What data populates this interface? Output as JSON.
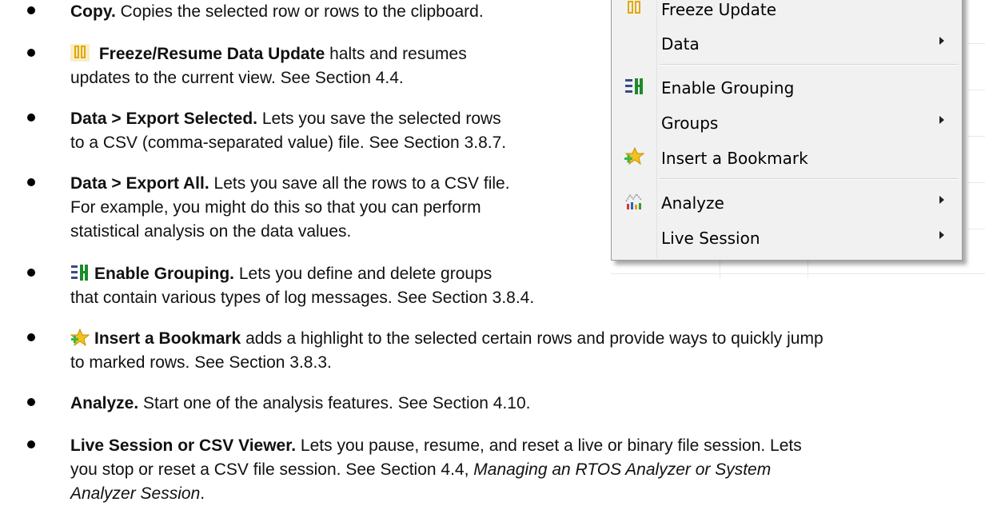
{
  "bullets": {
    "copy": {
      "title": "Copy.",
      "text": " Copies the selected row or rows to the clipboard."
    },
    "freeze": {
      "title": "Freeze/Resume Data Update",
      "text1": " halts and resumes",
      "text2": "updates to the current view. See Section 4.4."
    },
    "export_selected": {
      "title": "Data > Export Selected.",
      "text1": " Lets you save the selected rows",
      "text2": "to a CSV (comma-separated value) file. See Section 3.8.7."
    },
    "export_all": {
      "title": "Data > Export All.",
      "text1": " Lets you save all the rows to a CSV file.",
      "text2": "For example, you might do this so that you can perform",
      "text3": "statistical analysis on the data values."
    },
    "grouping": {
      "title": "Enable Grouping.",
      "text1": " Lets you define and delete groups",
      "text2": "that contain various types of log messages. See Section 3.8.4."
    },
    "bookmark": {
      "title": "Insert a Bookmark",
      "text1": " adds a highlight to the selected certain rows and provide ways to quickly jump",
      "text2": "to marked rows. See Section 3.8.3."
    },
    "analyze": {
      "title": "Analyze.",
      "text": " Start one of the analysis features. See Section 4.10."
    },
    "live": {
      "title": "Live Session or CSV Viewer.",
      "text1": " Lets you pause, resume, and reset a live or binary file session. Lets",
      "text2": "you stop or reset a CSV file session. See Section 4.4, ",
      "italic1": "Managing an RTOS Analyzer or System",
      "italic2": "Analyzer Session",
      "tail": "."
    }
  },
  "menu": {
    "items": [
      {
        "label": "Freeze Update",
        "icon": "freeze-icon",
        "submenu": false
      },
      {
        "label": "Data",
        "icon": "",
        "submenu": true
      },
      {
        "label": "Enable Grouping",
        "icon": "grouping-icon",
        "submenu": false
      },
      {
        "label": "Groups",
        "icon": "",
        "submenu": true
      },
      {
        "label": "Insert a Bookmark",
        "icon": "bookmark-icon",
        "submenu": false
      },
      {
        "label": "Analyze",
        "icon": "analyze-icon",
        "submenu": true
      },
      {
        "label": "Live Session",
        "icon": "",
        "submenu": true
      }
    ]
  },
  "colors": {
    "freeze_icon": "#e8b400",
    "grouping_icon": "#1c8a2a",
    "bookmark_icon": "#f3c21b",
    "menu_bg": "#f1f1f1"
  }
}
